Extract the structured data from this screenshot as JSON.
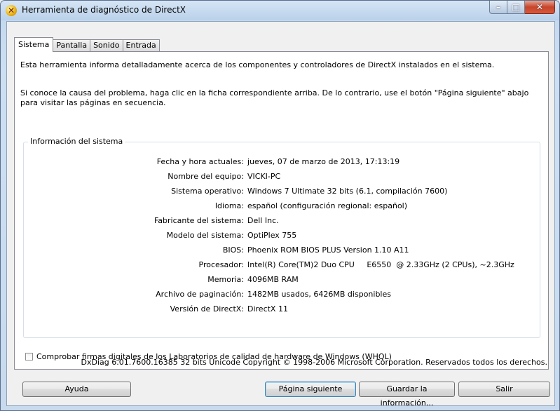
{
  "window": {
    "title": "Herramienta de diagnóstico de DirectX",
    "title_icon": "directx-x-icon",
    "caption": {
      "minimize": "–",
      "maximize": "□",
      "close": "✕"
    }
  },
  "tabs": [
    {
      "label": "Sistema",
      "active": true
    },
    {
      "label": "Pantalla",
      "active": false
    },
    {
      "label": "Sonido",
      "active": false
    },
    {
      "label": "Entrada",
      "active": false
    }
  ],
  "panel": {
    "intro": "Esta herramienta informa detalladamente acerca de los componentes y controladores de DirectX instalados en el sistema.",
    "instructions": "Si conoce la causa del problema, haga clic en la ficha correspondiente arriba. De lo contrario, use el botón \"Página siguiente\" abajo para visitar las páginas en secuencia.",
    "group_title": "Información del sistema",
    "rows": [
      {
        "label": "Fecha y hora actuales:",
        "value": "jueves, 07 de marzo de 2013, 17:13:19"
      },
      {
        "label": "Nombre del equipo:",
        "value": "VICKI-PC"
      },
      {
        "label": "Sistema operativo:",
        "value": "Windows 7 Ultimate 32 bits (6.1, compilación 7600)"
      },
      {
        "label": "Idioma:",
        "value": "español (configuración regional: español)"
      },
      {
        "label": "Fabricante del sistema:",
        "value": "Dell Inc."
      },
      {
        "label": "Modelo del sistema:",
        "value": "OptiPlex 755"
      },
      {
        "label": "BIOS:",
        "value": "Phoenix ROM BIOS PLUS Version 1.10 A11"
      },
      {
        "label": "Procesador:",
        "value": "Intel(R) Core(TM)2 Duo CPU     E6550  @ 2.33GHz (2 CPUs), ~2.3GHz"
      },
      {
        "label": "Memoria:",
        "value": "4096MB RAM"
      },
      {
        "label": "Archivo de paginación:",
        "value": "1482MB usados, 6426MB disponibles"
      },
      {
        "label": "Versión de DirectX:",
        "value": "DirectX 11"
      }
    ],
    "whql_label": "Comprobar firmas digitales de los Laboratorios de calidad de hardware de Windows (WHQL)",
    "whql_checked": false
  },
  "footer": {
    "copyright": "DxDiag 6.01.7600.16385 32 bits  Unicode  Copyright © 1998-2006 Microsoft Corporation. Reservados todos los derechos."
  },
  "buttons": {
    "help": "Ayuda",
    "next_page": "Página siguiente",
    "save_info": "Guardar la información...",
    "exit": "Salir"
  }
}
